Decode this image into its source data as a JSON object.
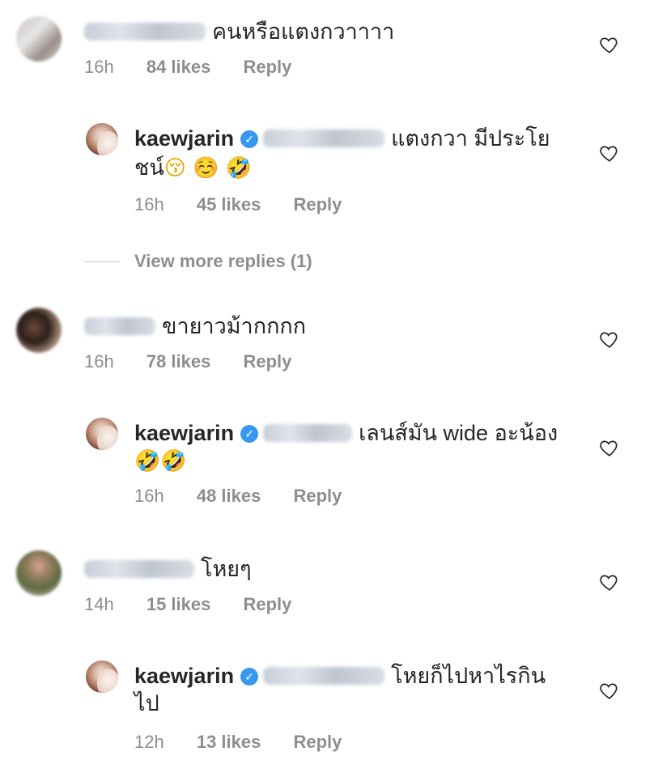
{
  "comments": [
    {
      "id": "c1",
      "text": "คนหรือแตงกวาาาา",
      "time": "16h",
      "likes": "84 likes",
      "reply": "Reply"
    },
    {
      "id": "r1",
      "username": "kaewjarin",
      "text_line1": "แตงกวา มีประโย",
      "text_line2_text": "ชน์",
      "text_line2_emoji": "😚 ☺️ 🤣",
      "time": "16h",
      "likes": "45 likes",
      "reply": "Reply"
    },
    {
      "id": "c2",
      "text": "ขายาวม้ากกกก",
      "time": "16h",
      "likes": "78 likes",
      "reply": "Reply"
    },
    {
      "id": "r2",
      "username": "kaewjarin",
      "text_line1": "เลนส์มัน wide อะน้อง",
      "text_line2_emoji": "🤣🤣",
      "time": "16h",
      "likes": "48 likes",
      "reply": "Reply"
    },
    {
      "id": "c3",
      "text": "โหยๆ",
      "time": "14h",
      "likes": "15 likes",
      "reply": "Reply"
    },
    {
      "id": "r3",
      "username": "kaewjarin",
      "text_line1": "โหยก็ไปหาไรกิน",
      "text_line2_text": "ไป",
      "time": "12h",
      "likes": "13 likes",
      "reply": "Reply"
    }
  ],
  "view_more_replies": "View more replies (1)",
  "icons": {
    "like": "heart-outline-icon",
    "verified": "verified-badge-icon"
  },
  "colors": {
    "verified": "#3897f0",
    "meta_text": "#8e8e8e",
    "text": "#262626"
  }
}
